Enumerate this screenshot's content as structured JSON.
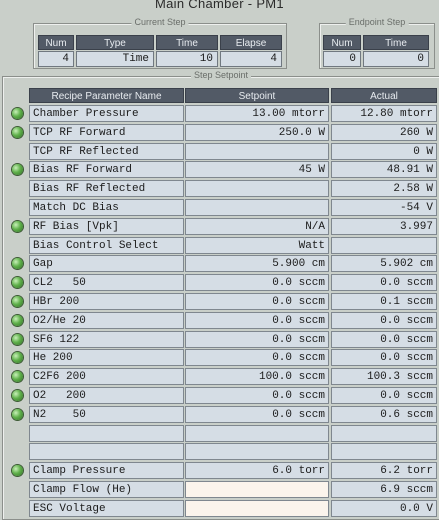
{
  "window": {
    "title": "Main Chamber - PM1"
  },
  "current_step": {
    "title": "Current Step",
    "headers": [
      "Num",
      "Type",
      "Time",
      "Elapse"
    ],
    "values": [
      "4",
      "Time",
      "10",
      "4"
    ]
  },
  "endpoint_step": {
    "title": "Endpoint Step",
    "headers": [
      "Num",
      "Time"
    ],
    "values": [
      "0",
      "0"
    ]
  },
  "step_setpoint": {
    "title": "Step Setpoint",
    "headers": {
      "name": "Recipe Parameter Name",
      "setpoint": "Setpoint",
      "actual": "Actual"
    },
    "rows": [
      {
        "led": true,
        "name": "Chamber Pressure",
        "setpoint": "13.00 mtorr",
        "actual": "12.80 mtorr"
      },
      {
        "led": true,
        "name": "TCP RF Forward",
        "setpoint": "250.0 W",
        "actual": "260 W"
      },
      {
        "led": false,
        "name": "TCP RF Reflected",
        "setpoint": "",
        "actual": "0 W"
      },
      {
        "led": true,
        "name": "Bias RF Forward",
        "setpoint": "45 W",
        "actual": "48.91 W"
      },
      {
        "led": false,
        "name": "Bias RF Reflected",
        "setpoint": "",
        "actual": "2.58 W"
      },
      {
        "led": false,
        "name": "Match DC Bias",
        "setpoint": "",
        "actual": "-54 V"
      },
      {
        "led": true,
        "name": "RF Bias [Vpk]",
        "setpoint": "N/A",
        "actual": "3.997"
      },
      {
        "led": false,
        "name": "Bias Control Select",
        "setpoint": "Watt",
        "actual": ""
      },
      {
        "led": true,
        "name": "Gap",
        "setpoint": "5.900 cm",
        "actual": "5.902 cm"
      },
      {
        "led": true,
        "name": "CL2   50",
        "setpoint": "0.0 sccm",
        "actual": "0.0 sccm"
      },
      {
        "led": true,
        "name": "HBr 200",
        "setpoint": "0.0 sccm",
        "actual": "0.1 sccm"
      },
      {
        "led": true,
        "name": "O2/He 20",
        "setpoint": "0.0 sccm",
        "actual": "0.0 sccm"
      },
      {
        "led": true,
        "name": "SF6 122",
        "setpoint": "0.0 sccm",
        "actual": "0.0 sccm"
      },
      {
        "led": true,
        "name": "He 200",
        "setpoint": "0.0 sccm",
        "actual": "0.0 sccm"
      },
      {
        "led": true,
        "name": "C2F6 200",
        "setpoint": "100.0 sccm",
        "actual": "100.3 sccm"
      },
      {
        "led": true,
        "name": "O2   200",
        "setpoint": "0.0 sccm",
        "actual": "0.0 sccm"
      },
      {
        "led": true,
        "name": "N2    50",
        "setpoint": "0.0 sccm",
        "actual": "0.6 sccm"
      },
      {
        "led": false,
        "name": "",
        "setpoint": "",
        "actual": ""
      },
      {
        "led": false,
        "name": "",
        "setpoint": "",
        "actual": ""
      },
      {
        "led": true,
        "name": "Clamp Pressure",
        "setpoint": "6.0 torr",
        "actual": "6.2 torr"
      },
      {
        "led": false,
        "name": "Clamp Flow (He)",
        "setpoint": "",
        "actual": "6.9 sccm",
        "setpoint_input": true
      },
      {
        "led": false,
        "name": "ESC Voltage",
        "setpoint": "",
        "actual": "0.0 V",
        "setpoint_input": true
      }
    ]
  }
}
